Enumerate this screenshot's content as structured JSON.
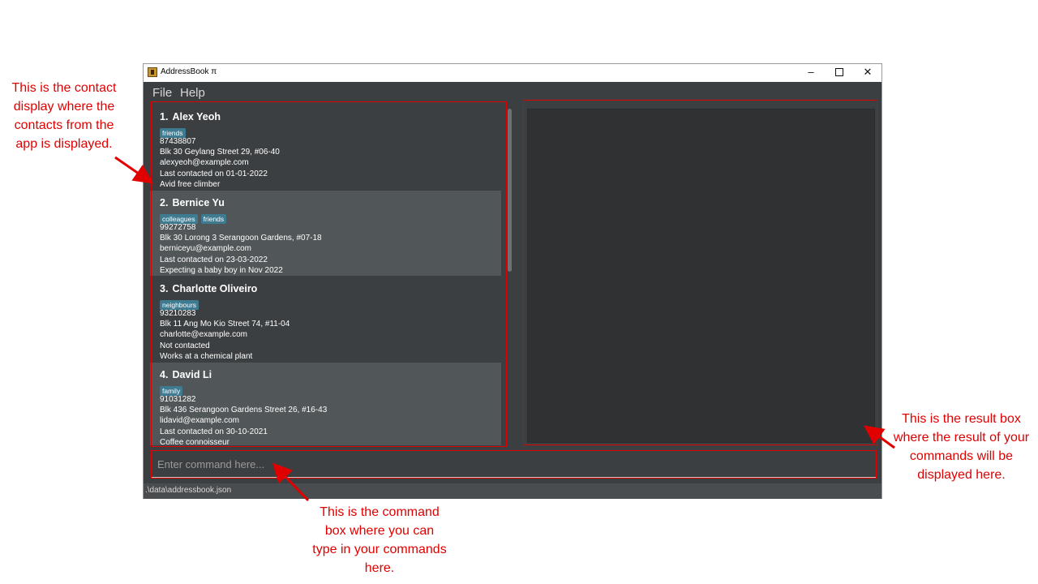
{
  "window": {
    "title": "AddressBook π",
    "controls": {
      "minimize": "–",
      "close": "✕"
    }
  },
  "menu": {
    "file": "File",
    "help": "Help"
  },
  "contacts": [
    {
      "index": "1.",
      "name": "Alex Yeoh",
      "tags": [
        "friends"
      ],
      "phone": "87438807",
      "address": "Blk 30 Geylang Street 29, #06-40",
      "email": "alexyeoh@example.com",
      "last_contacted": "Last contacted on 01-01-2022",
      "description": "Avid free climber"
    },
    {
      "index": "2.",
      "name": "Bernice Yu",
      "tags": [
        "colleagues",
        "friends"
      ],
      "phone": "99272758",
      "address": "Blk 30 Lorong 3 Serangoon Gardens, #07-18",
      "email": "berniceyu@example.com",
      "last_contacted": "Last contacted on 23-03-2022",
      "description": "Expecting a baby boy in Nov 2022"
    },
    {
      "index": "3.",
      "name": "Charlotte Oliveiro",
      "tags": [
        "neighbours"
      ],
      "phone": "93210283",
      "address": "Blk 11 Ang Mo Kio Street 74, #11-04",
      "email": "charlotte@example.com",
      "last_contacted": "Not contacted",
      "description": "Works at a chemical plant"
    },
    {
      "index": "4.",
      "name": "David Li",
      "tags": [
        "family"
      ],
      "phone": "91031282",
      "address": "Blk 436 Serangoon Gardens Street 26, #16-43",
      "email": "lidavid@example.com",
      "last_contacted": "Last contacted on 30-10-2021",
      "description": "Coffee connoisseur"
    }
  ],
  "result_box": {
    "text": ""
  },
  "command_box": {
    "placeholder": "Enter command here..."
  },
  "status_bar": {
    "path": ".\\data\\addressbook.json"
  },
  "annotations": {
    "contact_display": "This is the contact display where the contacts from the app is displayed.",
    "result_box": "This is the result box where the result of your commands will be displayed here.",
    "command_box": "This is the command box where you can type in your commands here."
  },
  "colors": {
    "background": "#3c3f41",
    "card_alt": "#515658",
    "tag": "#3e7b91",
    "annotation": "#e00000"
  }
}
